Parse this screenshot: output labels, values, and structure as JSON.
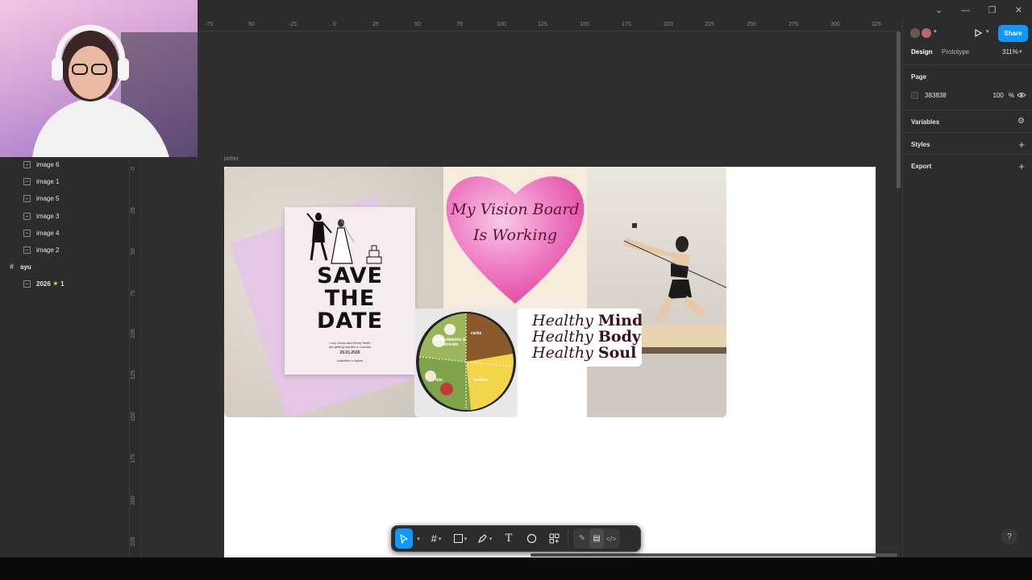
{
  "ruler": {
    "top": [
      "-75",
      "-50",
      "-25",
      "0",
      "25",
      "50",
      "75",
      "100",
      "125",
      "150",
      "175",
      "200",
      "225",
      "250",
      "275",
      "300",
      "325"
    ],
    "left": [
      "0",
      "25",
      "50",
      "75",
      "100",
      "125",
      "150",
      "175",
      "200",
      "225"
    ]
  },
  "layers": {
    "items": [
      "image 6",
      "image 1",
      "image 5",
      "image 3",
      "image 4",
      "image 2"
    ],
    "frame": "ayu",
    "child_name": "2026",
    "child_star": "★",
    "child_suffix": "1"
  },
  "canvas": {
    "frame_label": "potter",
    "save_the_date": {
      "line1": "SAVE",
      "line2": "THE",
      "line3": "DATE",
      "names": "Lucy Jones and Henry Smith",
      "sub": "are getting married in London",
      "date": "20.01.2026",
      "footer": "Invitation to follow"
    },
    "heart": {
      "line1": "My Vision Board",
      "line2": "Is Working"
    },
    "food": {
      "labels": [
        "carbs",
        "fibre, vitamins & minerals",
        "fats",
        "protein"
      ]
    },
    "healthy": [
      {
        "a": "Healthy",
        "b": "Mind"
      },
      {
        "a": "Healthy",
        "b": "Body"
      },
      {
        "a": "Healthy",
        "b": "Soul"
      }
    ]
  },
  "right_panel": {
    "share": "Share",
    "tab_design": "Design",
    "tab_prototype": "Prototype",
    "zoom": "311%",
    "page_heading": "Page",
    "page_color": "383838",
    "page_opacity": "100",
    "page_opacity_unit": "%",
    "variables": "Variables",
    "styles": "Styles",
    "export": "Export",
    "accent_color": "#0d99ff"
  },
  "toolbar": {
    "tools": [
      "move-tool",
      "frame-tool",
      "shape-tool",
      "pen-tool",
      "text-tool",
      "comment-tool",
      "assets-tool"
    ]
  },
  "help": "?"
}
